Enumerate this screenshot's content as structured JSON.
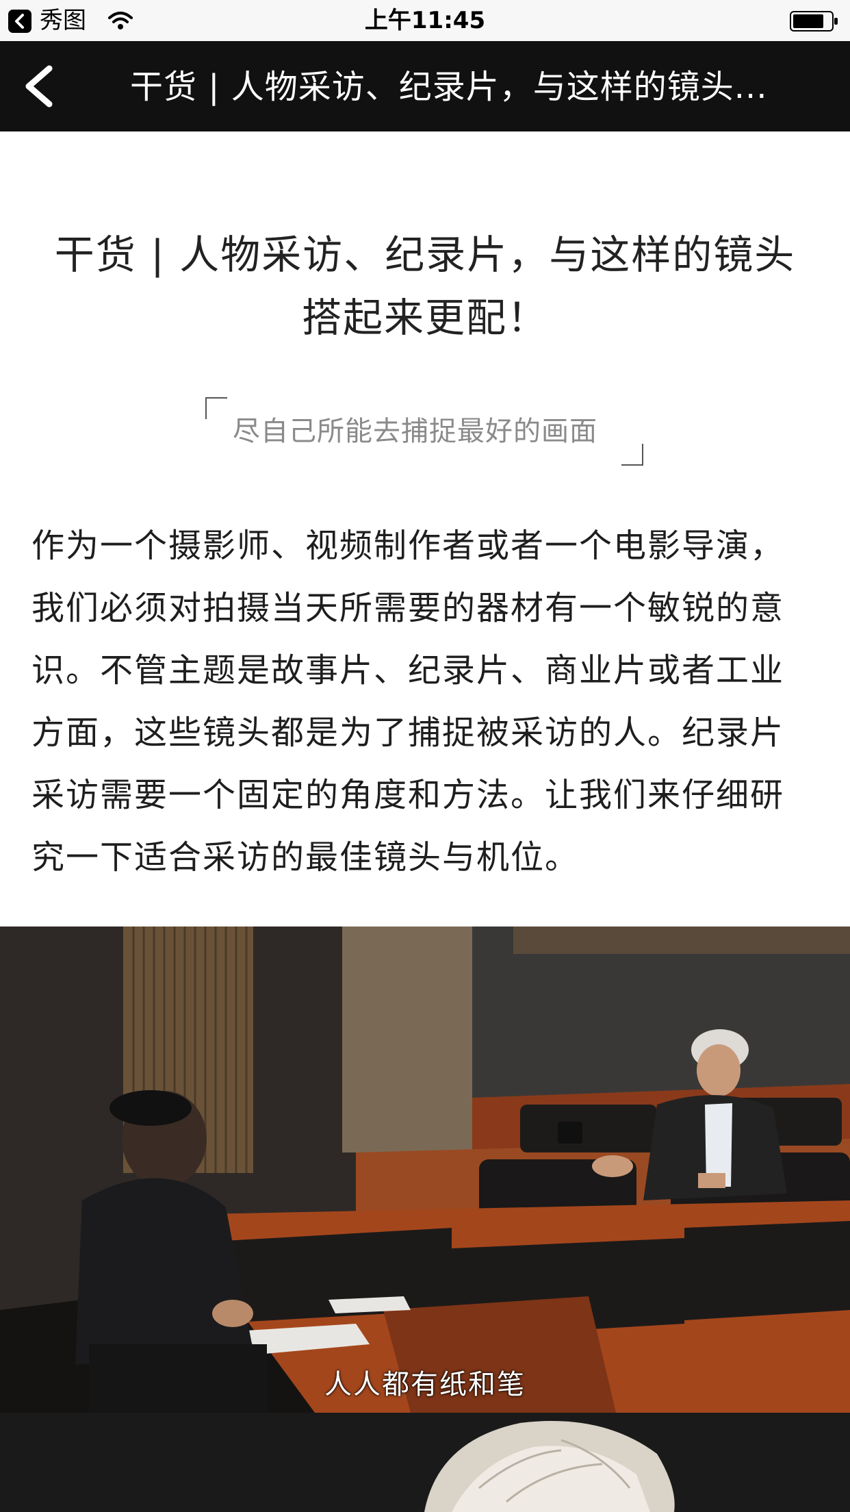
{
  "status_bar": {
    "app_name": "秀图",
    "time": "上午11:45"
  },
  "nav": {
    "title": "干货 | 人物采访、纪录片，与这样的镜头..."
  },
  "article": {
    "title_line1": "干货 | 人物采访、纪录片，与这样的镜头",
    "title_line2": "搭起来更配！",
    "quote": "尽自己所能去捕捉最好的画面",
    "paragraph_lines": [
      "作为一个摄影师、视频制作者或者一个电影导演，",
      "我们必须对拍摄当天所需要的器材有一个敏锐的意",
      "识。不管主题是故事片、纪录片、商业片或者工业",
      "方面，这些镜头都是为了捕捉被采访的人。纪录片",
      "采访需要一个固定的角度和方法。让我们来仔细研",
      "究一下适合采访的最佳镜头与机位。"
    ],
    "image_subtitle": "人人都有纸和笔"
  }
}
